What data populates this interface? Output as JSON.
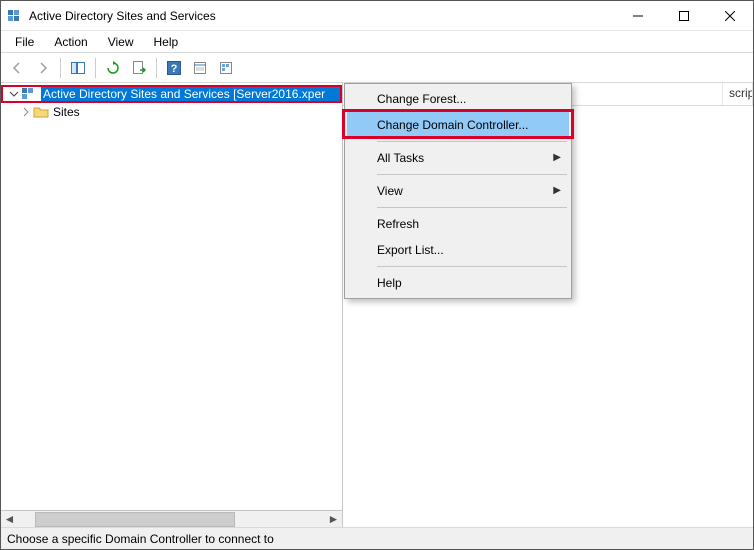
{
  "window": {
    "title": "Active Directory Sites and Services"
  },
  "menubar": {
    "file": "File",
    "action": "Action",
    "view": "View",
    "help": "Help"
  },
  "tree": {
    "root_label": "Active Directory Sites and Services [Server2016.xper",
    "sites_label": "Sites"
  },
  "list_header": {
    "col_description": "scription"
  },
  "context_menu": {
    "change_forest": "Change Forest...",
    "change_dc": "Change Domain Controller...",
    "all_tasks": "All Tasks",
    "view": "View",
    "refresh": "Refresh",
    "export_list": "Export List...",
    "help": "Help"
  },
  "statusbar": {
    "text": "Choose a specific Domain Controller to connect to"
  }
}
